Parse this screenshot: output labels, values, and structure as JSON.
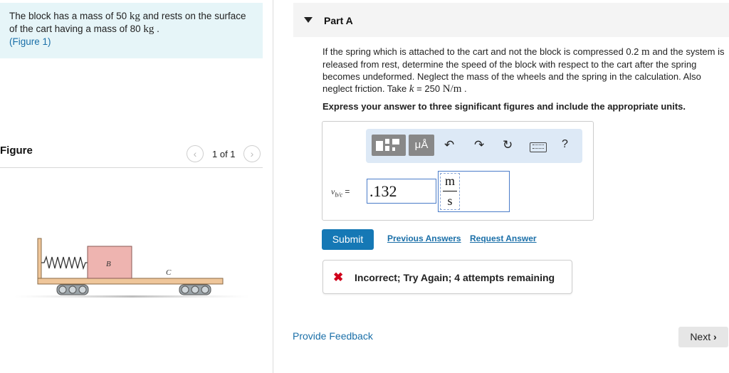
{
  "problem": {
    "line1_pre": "The block has a mass of 50",
    "unit_kg_1": "kg",
    "line1_post": "and rests on the surface",
    "line2_pre": "of the cart having a mass of 80",
    "unit_kg_2": "kg",
    "line2_post": ".",
    "figure_link": "(Figure 1)"
  },
  "figure": {
    "label": "Figure",
    "pager_text": "1 of 1",
    "prev_icon": "chevron-left-icon",
    "next_icon": "chevron-right-icon",
    "block_label": "B",
    "cart_label": "C",
    "block_color": "#eeb4b0",
    "cart_color": "#efc69a"
  },
  "part": {
    "title": "Part A",
    "question_1": "If the spring which is attached to the cart and not the block is compressed 0.2",
    "unit_m": "m",
    "question_2": " and the system is released from rest, determine the speed of the block with respect to the cart after the spring becomes undeformed. Neglect the mass of the wheels and the spring in the calculation. Also neglect friction. Take ",
    "k_symbol": "k",
    "k_eq": " = 250 ",
    "k_unit": "N/m",
    "k_end": " .",
    "instruction": "Express your answer to three significant figures and include the appropriate units."
  },
  "toolbar": {
    "templates_icon": "templates-icon",
    "units_label": "μÅ",
    "undo_icon": "undo-icon",
    "redo_icon": "redo-icon",
    "reset_icon": "reset-icon",
    "keyboard_icon": "keyboard-icon",
    "help_label": "?"
  },
  "answer": {
    "variable_label": "v",
    "variable_sub": "b/c",
    "equals": "=",
    "value": ".132",
    "unit_numerator": "m",
    "unit_denominator": "s"
  },
  "actions": {
    "submit_label": "Submit",
    "previous_answers": "Previous Answers",
    "request_answer": "Request Answer"
  },
  "feedback": {
    "icon": "x-icon",
    "text": "Incorrect; Try Again; 4 attempts remaining",
    "status_color": "#d0021b"
  },
  "footer": {
    "provide_feedback": "Provide Feedback",
    "next_label": "Next"
  }
}
